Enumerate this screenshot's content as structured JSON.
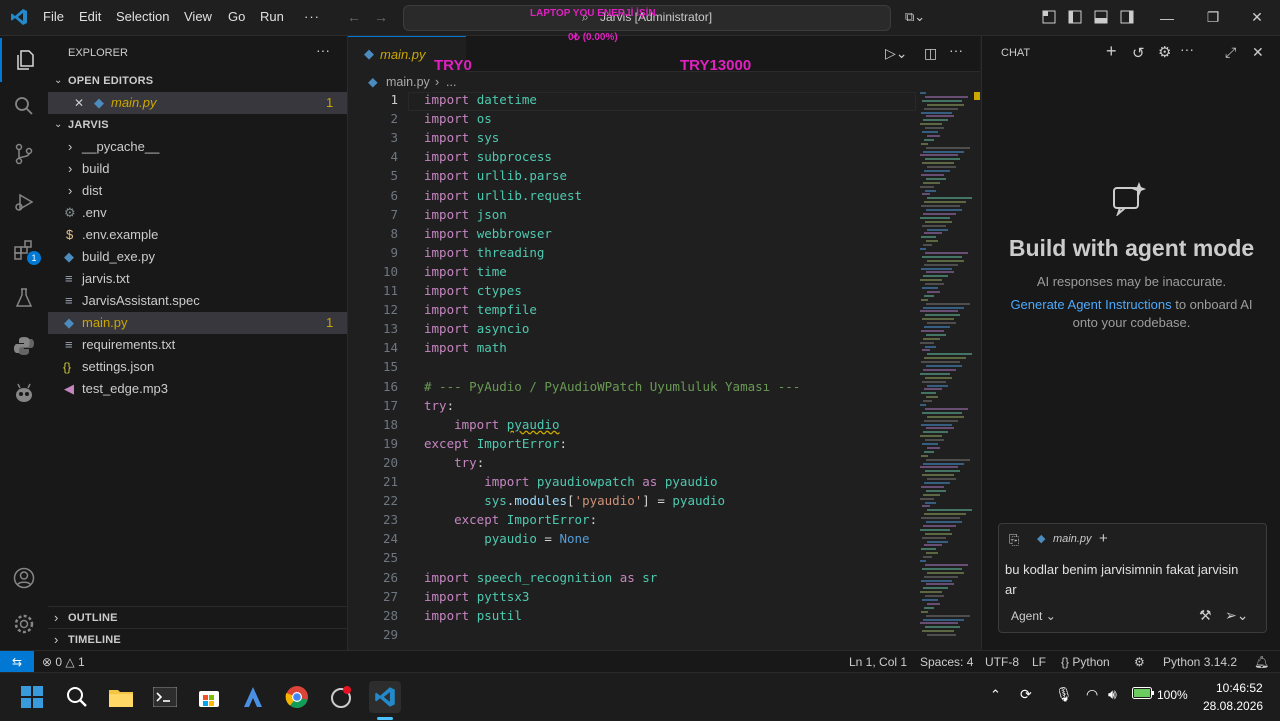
{
  "menu": [
    "File",
    "Edit",
    "Selection",
    "View",
    "Go",
    "Run"
  ],
  "title": {
    "search_text": "Jarvis [Administrator]"
  },
  "overlay": {
    "line1": "LAPTOP YOU ENERJİ İŞİN",
    "line2": "0₺ (0.00%)",
    "left_label": "TRY0",
    "right_label": "TRY13000"
  },
  "sidebar": {
    "header": "EXPLORER",
    "open_editors_label": "OPEN EDITORS",
    "open_editor_file": "main.py",
    "open_editor_badge": "1",
    "project_label": "JARVIS",
    "files": [
      {
        "name": "__pycache__",
        "kind": "folder"
      },
      {
        "name": "build",
        "kind": "folder"
      },
      {
        "name": "dist",
        "kind": "folder"
      },
      {
        "name": ".env",
        "kind": "gear"
      },
      {
        "name": ".env.example",
        "kind": "dollar"
      },
      {
        "name": "build_exe.py",
        "kind": "python"
      },
      {
        "name": "jarvis.txt",
        "kind": "text"
      },
      {
        "name": "JarvisAssistant.spec",
        "kind": "text"
      },
      {
        "name": "main.py",
        "kind": "python",
        "badge": "1"
      },
      {
        "name": "requirements.txt",
        "kind": "text"
      },
      {
        "name": "settings.json",
        "kind": "json"
      },
      {
        "name": "test_edge.mp3",
        "kind": "audio"
      }
    ],
    "outline_label": "OUTLINE",
    "timeline_label": "TIMELINE"
  },
  "editor": {
    "tab_label": "main.py",
    "breadcrumb_file": "main.py",
    "breadcrumb_rest": "...",
    "lines": [
      {
        "n": "1",
        "t": [
          [
            "kw",
            "import "
          ],
          [
            "md",
            "datetime"
          ]
        ]
      },
      {
        "n": "2",
        "t": [
          [
            "kw",
            "import "
          ],
          [
            "md",
            "os"
          ]
        ]
      },
      {
        "n": "3",
        "t": [
          [
            "kw",
            "import "
          ],
          [
            "md",
            "sys"
          ]
        ]
      },
      {
        "n": "4",
        "t": [
          [
            "kw",
            "import "
          ],
          [
            "md",
            "subprocess"
          ]
        ]
      },
      {
        "n": "5",
        "t": [
          [
            "kw",
            "import "
          ],
          [
            "md",
            "urllib.parse"
          ]
        ]
      },
      {
        "n": "6",
        "t": [
          [
            "kw",
            "import "
          ],
          [
            "md",
            "urllib.request"
          ]
        ]
      },
      {
        "n": "7",
        "t": [
          [
            "kw",
            "import "
          ],
          [
            "md",
            "json"
          ]
        ]
      },
      {
        "n": "8",
        "t": [
          [
            "kw",
            "import "
          ],
          [
            "md",
            "webbrowser"
          ]
        ]
      },
      {
        "n": "9",
        "t": [
          [
            "kw",
            "import "
          ],
          [
            "md",
            "threading"
          ]
        ]
      },
      {
        "n": "10",
        "t": [
          [
            "kw",
            "import "
          ],
          [
            "md",
            "time"
          ]
        ]
      },
      {
        "n": "11",
        "t": [
          [
            "kw",
            "import "
          ],
          [
            "md",
            "ctypes"
          ]
        ]
      },
      {
        "n": "12",
        "t": [
          [
            "kw",
            "import "
          ],
          [
            "md",
            "tempfile"
          ]
        ]
      },
      {
        "n": "13",
        "t": [
          [
            "kw",
            "import "
          ],
          [
            "md",
            "asyncio"
          ]
        ]
      },
      {
        "n": "14",
        "t": [
          [
            "kw",
            "import "
          ],
          [
            "md",
            "math"
          ]
        ]
      },
      {
        "n": "15",
        "t": []
      },
      {
        "n": "16",
        "t": [
          [
            "cm",
            "# --- PyAudio / PyAudioWPatch Uyumluluk Yaması ---"
          ]
        ]
      },
      {
        "n": "17",
        "t": [
          [
            "kw",
            "try"
          ],
          [
            "pl",
            ":"
          ]
        ]
      },
      {
        "n": "18",
        "t": [
          [
            "pl",
            "    "
          ],
          [
            "kw",
            "import "
          ],
          [
            "squig",
            "pyaudio"
          ]
        ]
      },
      {
        "n": "19",
        "t": [
          [
            "kw",
            "except "
          ],
          [
            "md",
            "ImportError"
          ],
          [
            "pl",
            ":"
          ]
        ]
      },
      {
        "n": "20",
        "t": [
          [
            "pl",
            "    "
          ],
          [
            "kw",
            "try"
          ],
          [
            "pl",
            ":"
          ]
        ]
      },
      {
        "n": "21",
        "t": [
          [
            "pl",
            "        "
          ],
          [
            "kw",
            "import "
          ],
          [
            "md",
            "pyaudiowpatch "
          ],
          [
            "kw",
            "as "
          ],
          [
            "md",
            "pyaudio"
          ]
        ]
      },
      {
        "n": "22",
        "t": [
          [
            "pl",
            "        "
          ],
          [
            "md",
            "sys"
          ],
          [
            "pl",
            "."
          ],
          [
            "vr",
            "modules"
          ],
          [
            "pl",
            "["
          ],
          [
            "st",
            "'pyaudio'"
          ],
          [
            "pl",
            "] = "
          ],
          [
            "md",
            "pyaudio"
          ]
        ]
      },
      {
        "n": "23",
        "t": [
          [
            "pl",
            "    "
          ],
          [
            "kw",
            "except "
          ],
          [
            "md",
            "ImportError"
          ],
          [
            "pl",
            ":"
          ]
        ]
      },
      {
        "n": "24",
        "t": [
          [
            "pl",
            "        "
          ],
          [
            "md",
            "pyaudio"
          ],
          [
            "pl",
            " = "
          ],
          [
            "cn",
            "None"
          ]
        ]
      },
      {
        "n": "25",
        "t": []
      },
      {
        "n": "26",
        "t": [
          [
            "kw",
            "import "
          ],
          [
            "md",
            "speech_recognition "
          ],
          [
            "kw",
            "as "
          ],
          [
            "md",
            "sr"
          ]
        ]
      },
      {
        "n": "27",
        "t": [
          [
            "kw",
            "import "
          ],
          [
            "md",
            "pyttsx3"
          ]
        ]
      },
      {
        "n": "28",
        "t": [
          [
            "kw",
            "import "
          ],
          [
            "md",
            "psutil"
          ]
        ]
      },
      {
        "n": "29",
        "t": []
      }
    ]
  },
  "chat": {
    "header": "CHAT",
    "heading": "Build with agent mode",
    "disclaimer": "AI responses may be inaccurate.",
    "link": "Generate Agent Instructions",
    "link_rest": " to onboard AI",
    "line2": "onto your codebase.",
    "attachment": "main.py",
    "input_text": "bu kodlar benim jarvisimnin fakat jarvisin ar",
    "mode": "Agent"
  },
  "status": {
    "problems": "0",
    "warnings": "1",
    "position": "Ln 1, Col 1",
    "spaces": "Spaces: 4",
    "encoding": "UTF-8",
    "eol": "LF",
    "language": "Python",
    "interpreter": "Python 3.14.2"
  },
  "taskbar": {
    "battery": "100%",
    "time": "10:46:52",
    "date": "28.08.2026"
  },
  "colors": {
    "accent": "#0078d4",
    "python_blue": "#4b8bbe",
    "badge_yellow": "#cca700"
  }
}
